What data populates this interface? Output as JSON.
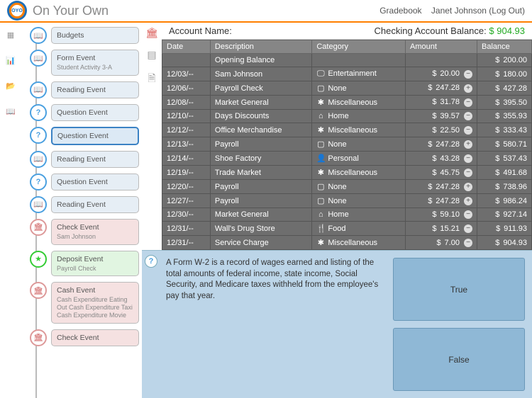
{
  "header": {
    "logo_text": "OYO",
    "title": "On Your Own",
    "gradebook": "Gradebook",
    "user": "Janet Johnson (Log Out)"
  },
  "timeline": [
    {
      "icon": "book",
      "title": "Budgets",
      "sub": "",
      "cls": ""
    },
    {
      "icon": "book",
      "title": "Form Event",
      "sub": "Student Activity 3-A",
      "cls": ""
    },
    {
      "icon": "book",
      "title": "Reading Event",
      "sub": "",
      "cls": ""
    },
    {
      "icon": "q",
      "title": "Question Event",
      "sub": "",
      "cls": ""
    },
    {
      "icon": "q",
      "title": "Question Event",
      "sub": "",
      "cls": "sel"
    },
    {
      "icon": "book",
      "title": "Reading Event",
      "sub": "",
      "cls": ""
    },
    {
      "icon": "q",
      "title": "Question Event",
      "sub": "",
      "cls": ""
    },
    {
      "icon": "book",
      "title": "Reading Event",
      "sub": "",
      "cls": ""
    },
    {
      "icon": "red",
      "title": "Check Event",
      "sub": "Sam Johnson",
      "cls": "pink"
    },
    {
      "icon": "star",
      "title": "Deposit Event",
      "sub": "Payroll Check",
      "cls": "green"
    },
    {
      "icon": "red",
      "title": "Cash Event",
      "sub": "Cash Expenditure Eating Out\nCash Expenditure Taxi\nCash Expenditure Movie",
      "cls": "pink"
    },
    {
      "icon": "red",
      "title": "Check Event",
      "sub": "",
      "cls": "pink"
    }
  ],
  "account": {
    "name_label": "Account Name:",
    "balance_label": "Checking Account Balance:",
    "balance": "$ 904.93"
  },
  "columns": [
    "Date",
    "Description",
    "Category",
    "Amount",
    "Balance"
  ],
  "rows": [
    {
      "date": "",
      "desc": "Opening Balance",
      "cat": "",
      "cati": "",
      "amt": "",
      "pm": "",
      "bal": "200.00"
    },
    {
      "date": "12/03/--",
      "desc": "Sam Johnson",
      "cat": "Entertainment",
      "cati": "🖵",
      "amt": "20.00",
      "pm": "−",
      "bal": "180.00"
    },
    {
      "date": "12/06/--",
      "desc": "Payroll Check",
      "cat": "None",
      "cati": "▢",
      "amt": "247.28",
      "pm": "+",
      "bal": "427.28"
    },
    {
      "date": "12/08/--",
      "desc": "Market General",
      "cat": "Miscellaneous",
      "cati": "✱",
      "amt": "31.78",
      "pm": "−",
      "bal": "395.50"
    },
    {
      "date": "12/10/--",
      "desc": "Days Discounts",
      "cat": "Home",
      "cati": "⌂",
      "amt": "39.57",
      "pm": "−",
      "bal": "355.93"
    },
    {
      "date": "12/12/--",
      "desc": "Office Merchandise",
      "cat": "Miscellaneous",
      "cati": "✱",
      "amt": "22.50",
      "pm": "−",
      "bal": "333.43"
    },
    {
      "date": "12/13/--",
      "desc": "Payroll",
      "cat": "None",
      "cati": "▢",
      "amt": "247.28",
      "pm": "+",
      "bal": "580.71"
    },
    {
      "date": "12/14/--",
      "desc": "Shoe Factory",
      "cat": "Personal",
      "cati": "👤",
      "amt": "43.28",
      "pm": "−",
      "bal": "537.43"
    },
    {
      "date": "12/19/--",
      "desc": "Trade Market",
      "cat": "Miscellaneous",
      "cati": "✱",
      "amt": "45.75",
      "pm": "−",
      "bal": "491.68"
    },
    {
      "date": "12/20/--",
      "desc": "Payroll",
      "cat": "None",
      "cati": "▢",
      "amt": "247.28",
      "pm": "+",
      "bal": "738.96"
    },
    {
      "date": "12/27/--",
      "desc": "Payroll",
      "cat": "None",
      "cati": "▢",
      "amt": "247.28",
      "pm": "+",
      "bal": "986.24"
    },
    {
      "date": "12/30/--",
      "desc": "Market General",
      "cat": "Home",
      "cati": "⌂",
      "amt": "59.10",
      "pm": "−",
      "bal": "927.14"
    },
    {
      "date": "12/31/--",
      "desc": "Wall's Drug Store",
      "cat": "Food",
      "cati": "🍴",
      "amt": "15.21",
      "pm": "−",
      "bal": "911.93"
    },
    {
      "date": "12/31/--",
      "desc": "Service Charge",
      "cat": "Miscellaneous",
      "cati": "✱",
      "amt": "7.00",
      "pm": "−",
      "bal": "904.93"
    }
  ],
  "question": {
    "text": "A Form W-2 is a record of wages earned and listing of the total amounts of federal income, state income, Social Security, and Medicare taxes withheld from the employee's pay that year.",
    "answers": [
      "True",
      "False"
    ]
  }
}
